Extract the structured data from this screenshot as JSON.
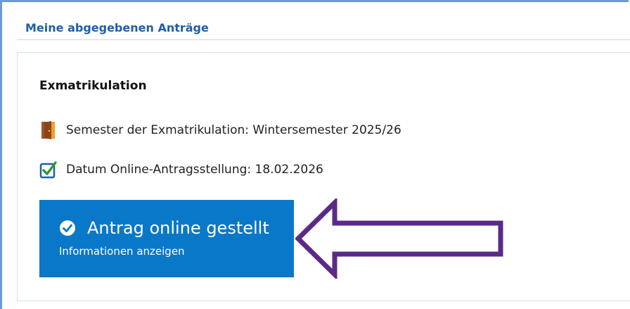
{
  "section": {
    "title": "Meine abgegebenen Anträge"
  },
  "application": {
    "heading": "Exmatrikulation",
    "semester_text": "Semester der Exmatrikulation: Wintersemester 2025/26",
    "date_text": "Datum Online-Antragsstellung: 18.02.2026",
    "status_button": {
      "label": "Antrag online gestellt",
      "sublabel": "Informationen anzeigen"
    }
  },
  "icons": [
    "door-icon",
    "checkbox-checked-icon",
    "check-circle-icon",
    "arrow-left-icon"
  ],
  "colors": {
    "title": "#1f5fa8",
    "button": "#0a78c8",
    "arrow": "#5b2a86"
  }
}
